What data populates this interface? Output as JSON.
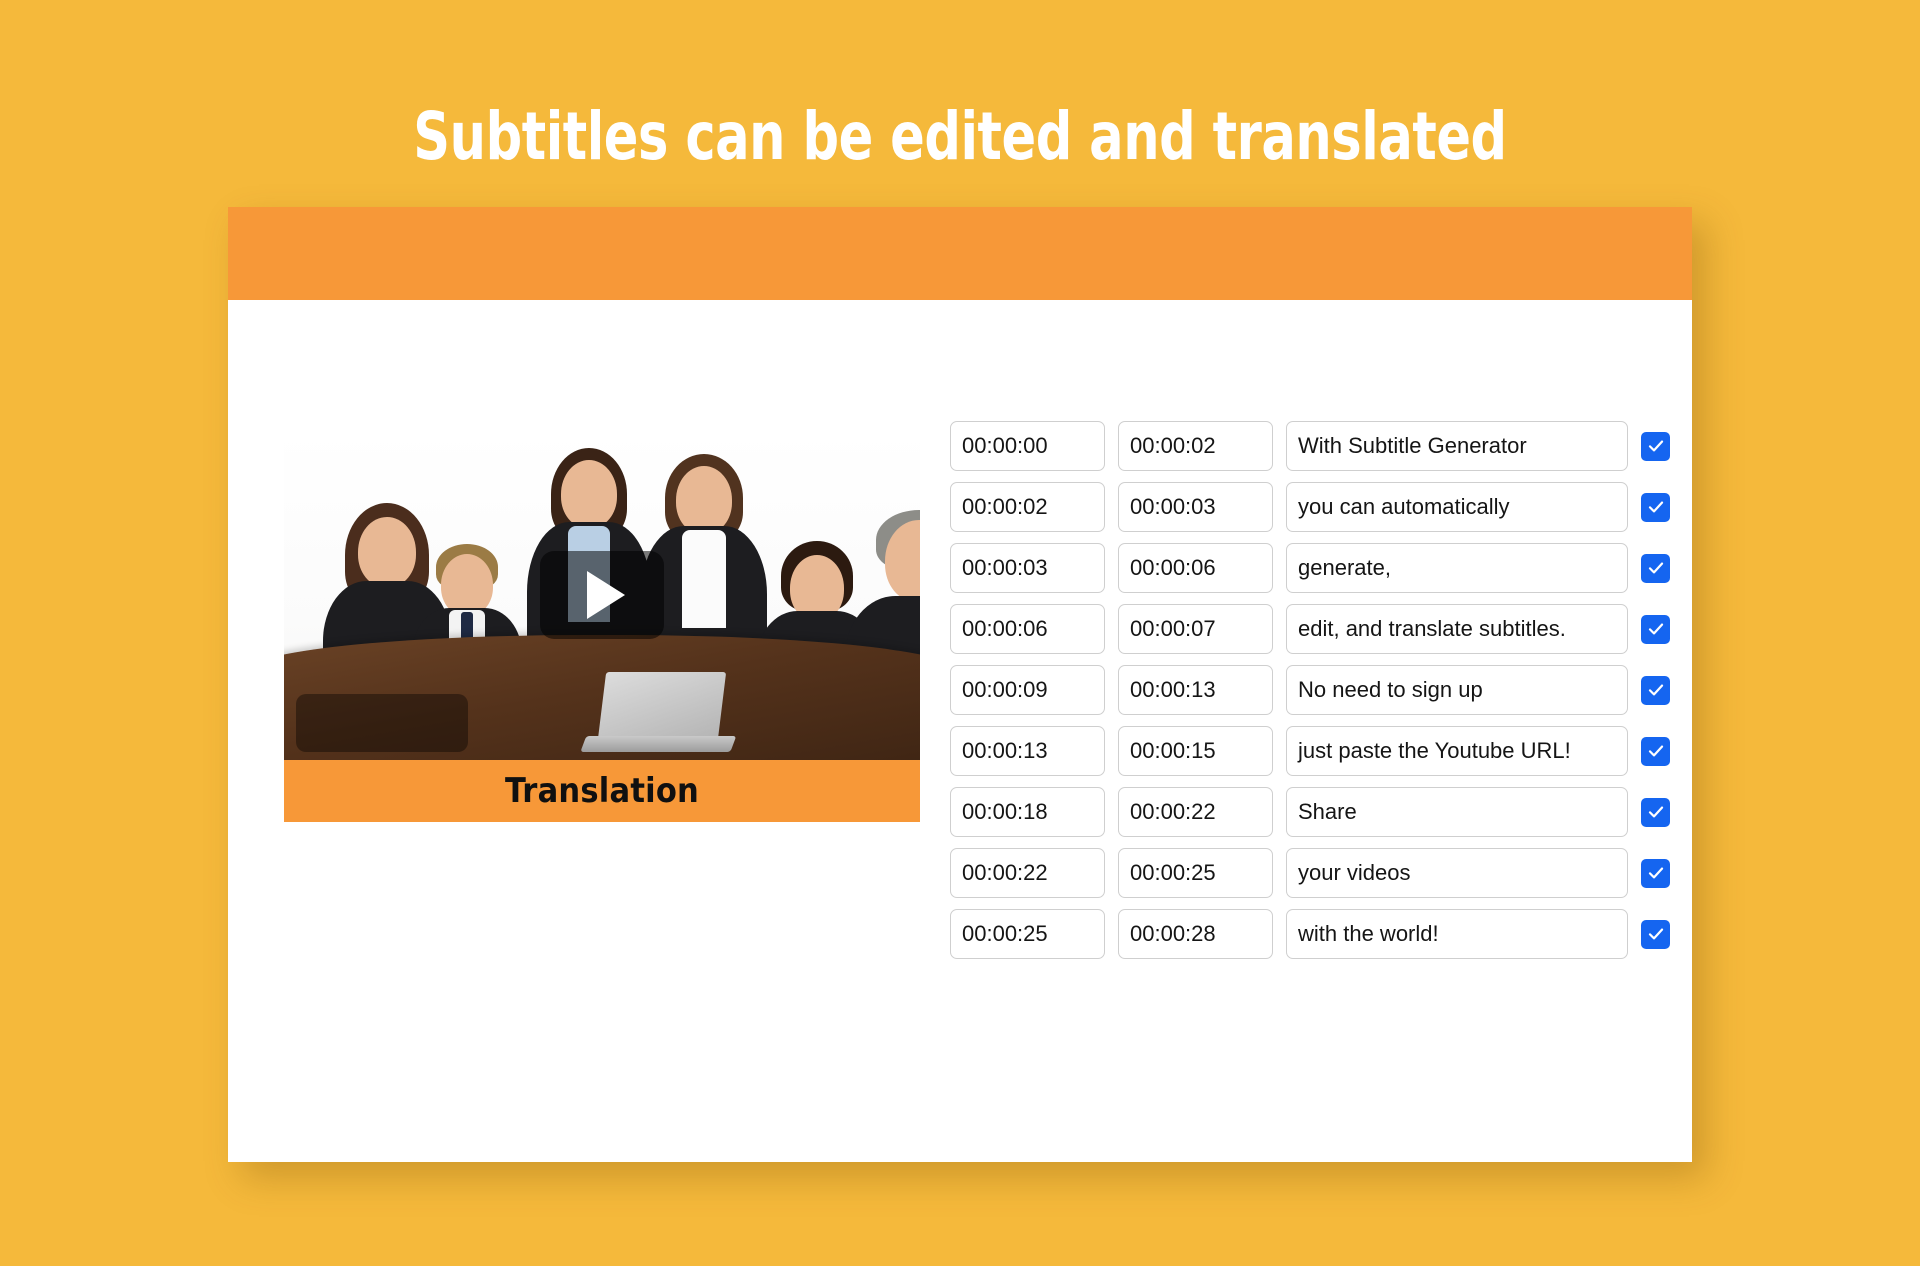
{
  "page": {
    "headline": "Subtitles can be edited and translated",
    "background_color": "#f5b93b"
  },
  "card": {
    "header": {
      "color": "#f79838",
      "label": ""
    },
    "accent_color": "#f79838",
    "checkbox_color": "#1565f0"
  },
  "video": {
    "play_icon": "play-icon",
    "caption": "Translation",
    "caption_bar_color": "#f79838"
  },
  "subtitles": {
    "rows": [
      {
        "start": "00:00:00",
        "end": "00:00:02",
        "text": "With Subtitle Generator",
        "checked": true
      },
      {
        "start": "00:00:02",
        "end": "00:00:03",
        "text": "you can automatically",
        "checked": true
      },
      {
        "start": "00:00:03",
        "end": "00:00:06",
        "text": "generate,",
        "checked": true
      },
      {
        "start": "00:00:06",
        "end": "00:00:07",
        "text": "edit, and translate subtitles.",
        "checked": true
      },
      {
        "start": "00:00:09",
        "end": "00:00:13",
        "text": "No need to sign up",
        "checked": true
      },
      {
        "start": "00:00:13",
        "end": "00:00:15",
        "text": "just paste the Youtube URL!",
        "checked": true
      },
      {
        "start": "00:00:18",
        "end": "00:00:22",
        "text": "Share",
        "checked": true
      },
      {
        "start": "00:00:22",
        "end": "00:00:25",
        "text": "your videos",
        "checked": true
      },
      {
        "start": "00:00:25",
        "end": "00:00:28",
        "text": "with the world!",
        "checked": true
      }
    ]
  }
}
